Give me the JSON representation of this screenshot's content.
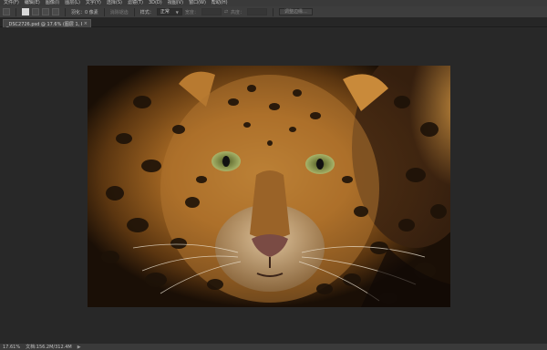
{
  "menubar": {
    "items": [
      "文件(F)",
      "编辑(E)",
      "图像(I)",
      "图层(L)",
      "文字(Y)",
      "选择(S)",
      "滤镜(T)",
      "3D(D)",
      "视图(V)",
      "窗口(W)",
      "帮助(H)"
    ]
  },
  "options": {
    "feather_label": "羽化：0 像素",
    "antialias_label": "消除锯齿",
    "style_label": "样式：",
    "style_value": "正常",
    "width_label": "宽度：",
    "height_label": "高度：",
    "refine_button": "调整边缘..."
  },
  "document": {
    "tab_title": "_DSC2726.psd @ 17.6% (图层 1, RGB/16) *",
    "close_glyph": "×"
  },
  "status": {
    "zoom": "17.61%",
    "doc_size": "文档:156.2M/312.4M",
    "arrow": "▶"
  },
  "colors": {
    "app_bg": "#282828",
    "panel_bg": "#3d3d3d"
  }
}
